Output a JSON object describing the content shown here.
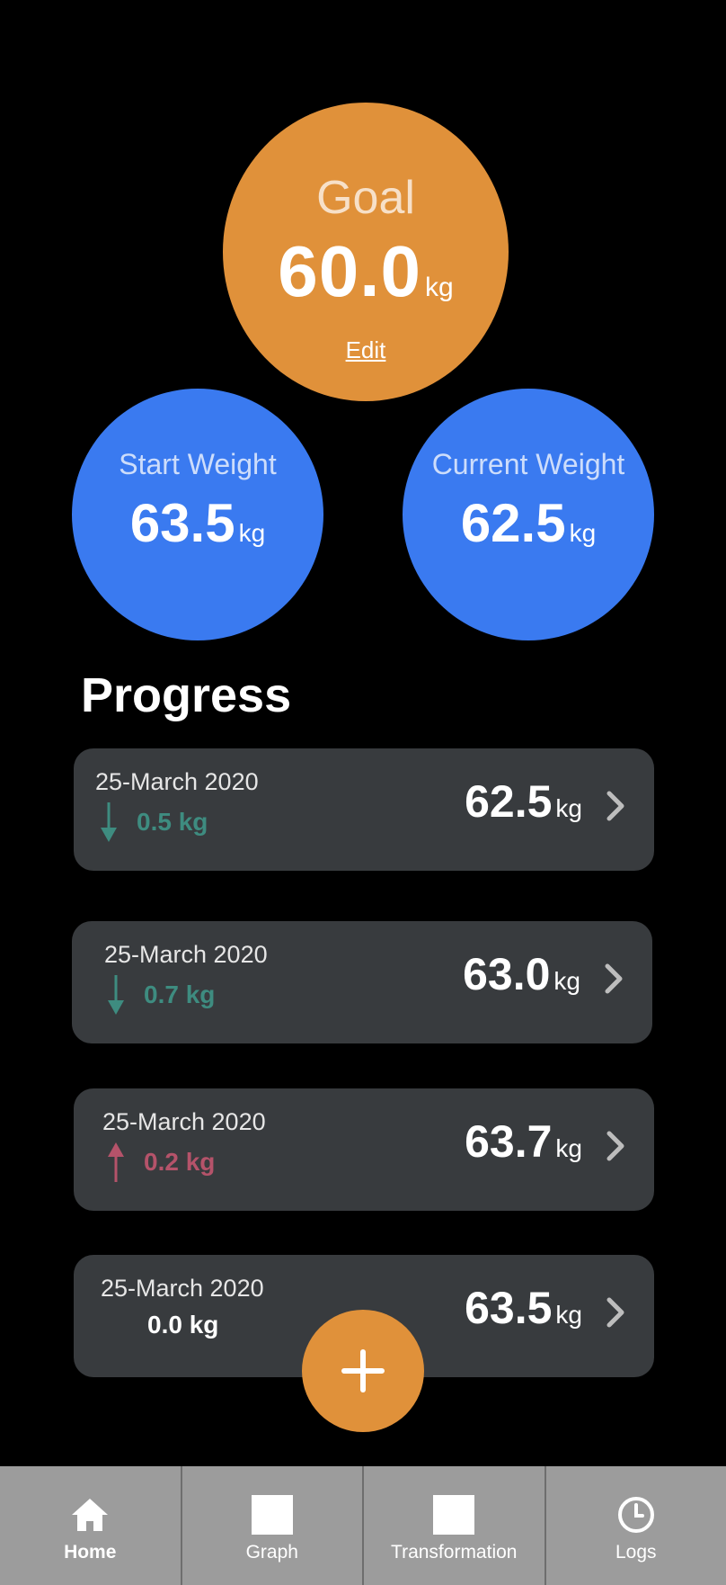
{
  "goal": {
    "label": "Goal",
    "value": "60.0",
    "unit": "kg",
    "edit_label": "Edit"
  },
  "start": {
    "label": "Start Weight",
    "value": "63.5",
    "unit": "kg"
  },
  "current": {
    "label": "Current Weight",
    "value": "62.5",
    "unit": "kg"
  },
  "progress": {
    "title": "Progress",
    "entries": [
      {
        "date": "25-March 2020",
        "delta": "0.5 kg",
        "direction": "down",
        "value": "62.5",
        "unit": "kg"
      },
      {
        "date": "25-March 2020",
        "delta": "0.7 kg",
        "direction": "down",
        "value": "63.0",
        "unit": "kg"
      },
      {
        "date": "25-March 2020",
        "delta": "0.2 kg",
        "direction": "up",
        "value": "63.7",
        "unit": "kg"
      },
      {
        "date": "25-March 2020",
        "delta": "0.0 kg",
        "direction": "none",
        "value": "63.5",
        "unit": "kg"
      }
    ]
  },
  "fab": {
    "icon": "plus-icon"
  },
  "tabs": [
    {
      "label": "Home",
      "icon": "home-icon",
      "active": true
    },
    {
      "label": "Graph",
      "icon": "graph-icon",
      "active": false
    },
    {
      "label": "Transformation",
      "icon": "transformation-icon",
      "active": false
    },
    {
      "label": "Logs",
      "icon": "clock-icon",
      "active": false
    }
  ],
  "colors": {
    "accent": "#E0913A",
    "blue": "#3A7AF0",
    "card": "#383B3E",
    "down": "#3E8C80",
    "up": "#B5536A",
    "tabbar": "#9C9C9C"
  }
}
